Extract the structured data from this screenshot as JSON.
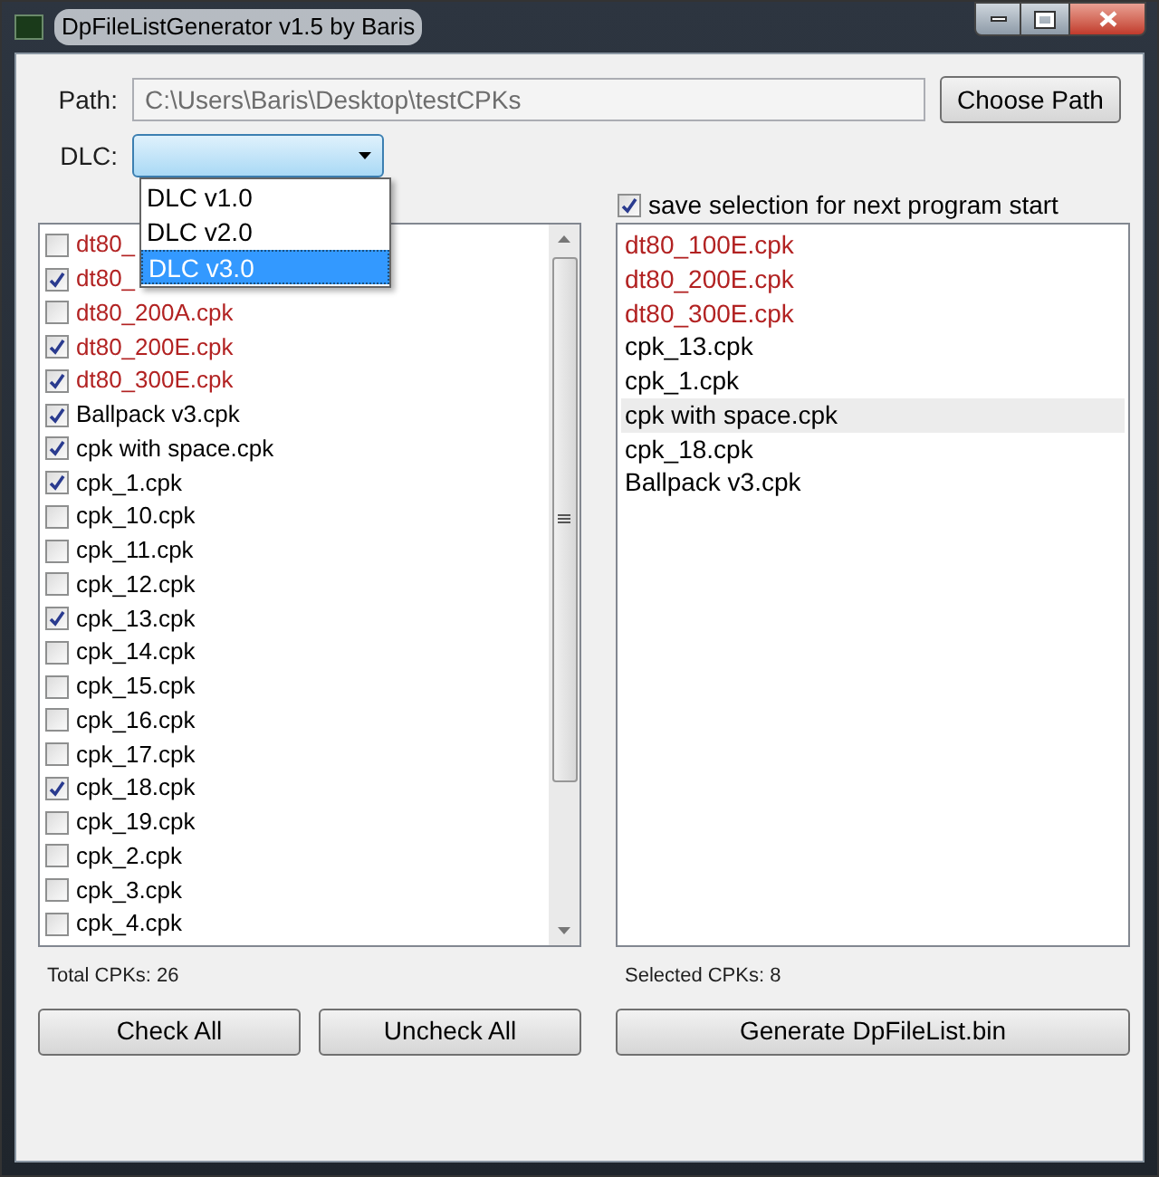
{
  "window": {
    "title": "DpFileListGenerator v1.5 by Baris"
  },
  "path": {
    "label": "Path:",
    "value": "C:\\Users\\Baris\\Desktop\\testCPKs",
    "button": "Choose Path"
  },
  "dlc": {
    "label": "DLC:",
    "expanded": true,
    "options": [
      {
        "label": "DLC v1.0",
        "selected": false
      },
      {
        "label": "DLC v2.0",
        "selected": false
      },
      {
        "label": "DLC v3.0",
        "selected": true
      }
    ]
  },
  "save_selection": {
    "label": "save selection for next program start",
    "checked": true
  },
  "cpk_list": [
    {
      "name": "dt80_",
      "checked": false,
      "color": "#b22222"
    },
    {
      "name": "dt80_",
      "checked": true,
      "color": "#b22222"
    },
    {
      "name": "dt80_200A.cpk",
      "checked": false,
      "color": "#b22222"
    },
    {
      "name": "dt80_200E.cpk",
      "checked": true,
      "color": "#b22222"
    },
    {
      "name": "dt80_300E.cpk",
      "checked": true,
      "color": "#b22222"
    },
    {
      "name": "Ballpack v3.cpk",
      "checked": true,
      "color": "#000000"
    },
    {
      "name": "cpk with space.cpk",
      "checked": true,
      "color": "#000000"
    },
    {
      "name": "cpk_1.cpk",
      "checked": true,
      "color": "#000000"
    },
    {
      "name": "cpk_10.cpk",
      "checked": false,
      "color": "#000000"
    },
    {
      "name": "cpk_11.cpk",
      "checked": false,
      "color": "#000000"
    },
    {
      "name": "cpk_12.cpk",
      "checked": false,
      "color": "#000000"
    },
    {
      "name": "cpk_13.cpk",
      "checked": true,
      "color": "#000000"
    },
    {
      "name": "cpk_14.cpk",
      "checked": false,
      "color": "#000000"
    },
    {
      "name": "cpk_15.cpk",
      "checked": false,
      "color": "#000000"
    },
    {
      "name": "cpk_16.cpk",
      "checked": false,
      "color": "#000000"
    },
    {
      "name": "cpk_17.cpk",
      "checked": false,
      "color": "#000000"
    },
    {
      "name": "cpk_18.cpk",
      "checked": true,
      "color": "#000000"
    },
    {
      "name": "cpk_19.cpk",
      "checked": false,
      "color": "#000000"
    },
    {
      "name": "cpk_2.cpk",
      "checked": false,
      "color": "#000000"
    },
    {
      "name": "cpk_3.cpk",
      "checked": false,
      "color": "#000000"
    },
    {
      "name": "cpk_4.cpk",
      "checked": false,
      "color": "#000000"
    }
  ],
  "selected_list": [
    {
      "name": "dt80_100E.cpk",
      "selected": false,
      "color": "#b22222"
    },
    {
      "name": "dt80_200E.cpk",
      "selected": false,
      "color": "#b22222"
    },
    {
      "name": "dt80_300E.cpk",
      "selected": false,
      "color": "#b22222"
    },
    {
      "name": "cpk_13.cpk",
      "selected": false,
      "color": "#000000"
    },
    {
      "name": "cpk_1.cpk",
      "selected": false,
      "color": "#000000"
    },
    {
      "name": "cpk with space.cpk",
      "selected": true,
      "color": "#000000"
    },
    {
      "name": "cpk_18.cpk",
      "selected": false,
      "color": "#000000"
    },
    {
      "name": "Ballpack v3.cpk",
      "selected": false,
      "color": "#000000"
    }
  ],
  "total_label": "Total CPKs: 26",
  "selected_label": "Selected CPKs: 8",
  "buttons": {
    "check_all": "Check All",
    "uncheck_all": "Uncheck All",
    "generate": "Generate DpFileList.bin"
  }
}
